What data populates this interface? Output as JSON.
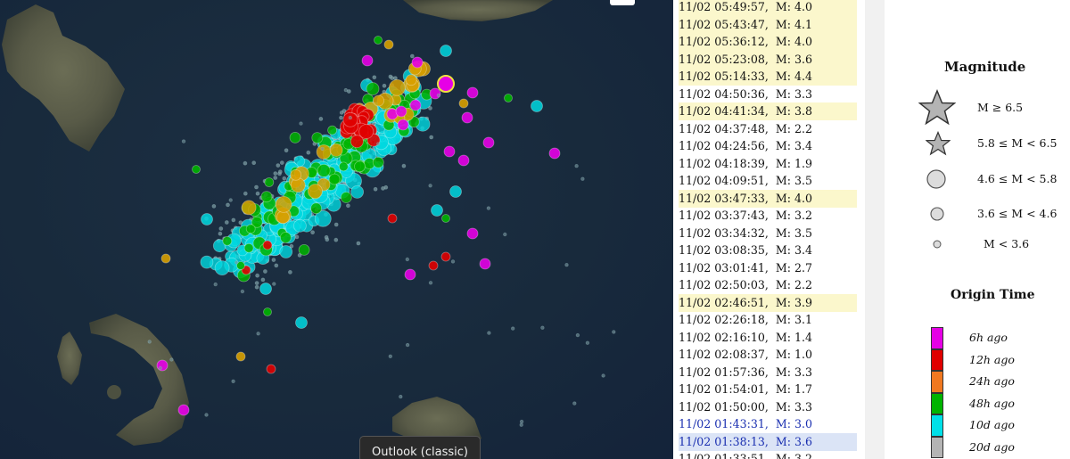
{
  "tooltip": "Outlook (classic)",
  "event_list": [
    {
      "time": "11/02 05:49:57,",
      "mag": "M: 4.0",
      "style": "hl"
    },
    {
      "time": "11/02 05:43:47,",
      "mag": "M: 4.1",
      "style": "hl"
    },
    {
      "time": "11/02 05:36:12,",
      "mag": "M: 4.0",
      "style": "hl"
    },
    {
      "time": "11/02 05:23:08,",
      "mag": "M: 3.6",
      "style": "hl"
    },
    {
      "time": "11/02 05:14:33,",
      "mag": "M: 4.4",
      "style": "hl"
    },
    {
      "time": "11/02 04:50:36,",
      "mag": "M: 3.3",
      "style": ""
    },
    {
      "time": "11/02 04:41:34,",
      "mag": "M: 3.8",
      "style": "hl"
    },
    {
      "time": "11/02 04:37:48,",
      "mag": "M: 2.2",
      "style": ""
    },
    {
      "time": "11/02 04:24:56,",
      "mag": "M: 3.4",
      "style": ""
    },
    {
      "time": "11/02 04:18:39,",
      "mag": "M: 1.9",
      "style": ""
    },
    {
      "time": "11/02 04:09:51,",
      "mag": "M: 3.5",
      "style": ""
    },
    {
      "time": "11/02 03:47:33,",
      "mag": "M: 4.0",
      "style": "hl"
    },
    {
      "time": "11/02 03:37:43,",
      "mag": "M: 3.2",
      "style": ""
    },
    {
      "time": "11/02 03:34:32,",
      "mag": "M: 3.5",
      "style": ""
    },
    {
      "time": "11/02 03:08:35,",
      "mag": "M: 3.4",
      "style": ""
    },
    {
      "time": "11/02 03:01:41,",
      "mag": "M: 2.7",
      "style": ""
    },
    {
      "time": "11/02 02:50:03,",
      "mag": "M: 2.2",
      "style": ""
    },
    {
      "time": "11/02 02:46:51,",
      "mag": "M: 3.9",
      "style": "hl"
    },
    {
      "time": "11/02 02:26:18,",
      "mag": "M: 3.1",
      "style": ""
    },
    {
      "time": "11/02 02:16:10,",
      "mag": "M: 1.4",
      "style": ""
    },
    {
      "time": "11/02 02:08:37,",
      "mag": "M: 1.0",
      "style": ""
    },
    {
      "time": "11/02 01:57:36,",
      "mag": "M: 3.3",
      "style": ""
    },
    {
      "time": "11/02 01:54:01,",
      "mag": "M: 1.7",
      "style": ""
    },
    {
      "time": "11/02 01:50:00,",
      "mag": "M: 3.3",
      "style": ""
    },
    {
      "time": "11/02 01:43:31,",
      "mag": "M: 3.0",
      "style": "blue"
    },
    {
      "time": "11/02 01:38:13,",
      "mag": "M: 3.6",
      "style": "sel"
    },
    {
      "time": "11/02 01:33:51,",
      "mag": "M: 3.2",
      "style": ""
    }
  ],
  "legend": {
    "magnitude_title": "Magnitude",
    "magnitude_classes": [
      {
        "label": "M ≥ 6.5",
        "symbol": "star-large"
      },
      {
        "label": "5.8 ≤  M  < 6.5",
        "symbol": "star-small"
      },
      {
        "label": "4.6 ≤  M  < 5.8",
        "symbol": "circle-large"
      },
      {
        "label": "3.6 ≤  M  < 4.6",
        "symbol": "circle-medium"
      },
      {
        "label": "M < 3.6",
        "symbol": "circle-small"
      }
    ],
    "time_title": "Origin Time",
    "time_classes": [
      {
        "label": "6h ago",
        "color": "#e600e6"
      },
      {
        "label": "12h ago",
        "color": "#e00000"
      },
      {
        "label": "24h ago",
        "color": "#f07820"
      },
      {
        "label": "48h ago",
        "color": "#00b400"
      },
      {
        "label": "10d ago",
        "color": "#00e0e8"
      },
      {
        "label": "20d ago",
        "color": "#b4b4b4"
      }
    ]
  },
  "map_colors": {
    "sea": "#182a3c",
    "land": "#5a5e48",
    "quake_6h": "#e600e6",
    "quake_12h": "#e00000",
    "quake_24h": "#d8a000",
    "quake_48h": "#00b400",
    "quake_10d": "#00d8e0",
    "quake_20d": "#7a9aa0"
  }
}
